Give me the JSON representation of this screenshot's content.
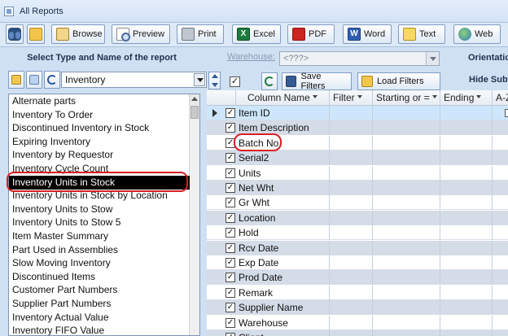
{
  "window": {
    "title": "All Reports"
  },
  "toolbar": {
    "buttons": [
      {
        "label": "Browse",
        "icon": "browse-icon"
      },
      {
        "label": "Preview",
        "icon": "preview-icon"
      },
      {
        "label": "Print",
        "icon": "print-icon"
      },
      {
        "label": "Excel",
        "icon": "excel-icon"
      },
      {
        "label": "PDF",
        "icon": "pdf-icon"
      },
      {
        "label": "Word",
        "icon": "word-icon"
      },
      {
        "label": "Text",
        "icon": "text-icon"
      },
      {
        "label": "Web",
        "icon": "web-icon"
      }
    ],
    "excel_glyph": "X",
    "word_glyph": "W"
  },
  "left_panel": {
    "header": "Select Type and Name of the report",
    "type_value": "Inventory",
    "reports": [
      "Alternate parts",
      "Inventory To Order",
      "Discontinued Inventory in Stock",
      "Expiring Inventory",
      "Inventory by Requestor",
      "Inventory Cycle Count",
      "Inventory Units in Stock",
      "Inventory Units in Stock by Location",
      "Inventory Units to Stow",
      "Inventory Units to Stow 5",
      "Item Master Summary",
      "Part Used in Assemblies",
      "Slow Moving Inventory",
      "Discontinued Items",
      "Customer Part Numbers",
      "Supplier Part Numbers",
      "Inventory Actual Value",
      "Inventory FIFO Value"
    ],
    "selected_index": 6
  },
  "filters": {
    "warehouse_label": "Warehouse:",
    "warehouse_value": "<???>",
    "orientation_label": "Orientatio",
    "hide_label": "Hide Subto",
    "save_filters": "Save Filters",
    "load_filters": "Load Filters",
    "check_all_mark": "✓"
  },
  "grid": {
    "columns": [
      "Column Name",
      "Filter",
      "Starting or =",
      "Ending",
      "A-Z"
    ],
    "check_mark": "✓",
    "rows": [
      "Item ID",
      "Item Description",
      "Batch No",
      "Serial2",
      "Units",
      "Net Wht",
      "Gr Wht",
      "Location",
      "Hold",
      "Rcv Date",
      "Exp Date",
      "Prod Date",
      "Remark",
      "Supplier Name",
      "Warehouse",
      "Client"
    ]
  },
  "colors": {
    "highlight_oval": "#d81f26",
    "selected_row_bg": "#000000",
    "first_row_bg": "#cde6fb"
  }
}
